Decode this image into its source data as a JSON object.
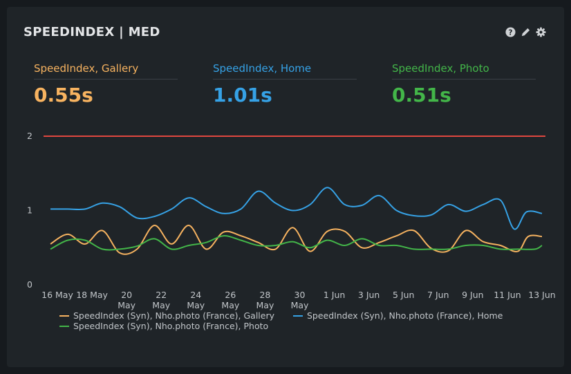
{
  "panel": {
    "title": "SPEEDINDEX | MED",
    "icons": [
      "help-icon",
      "edit-icon",
      "gear-icon"
    ]
  },
  "metrics": [
    {
      "label": "SpeedIndex, Gallery",
      "value": "0.55s",
      "color": "#f7b360"
    },
    {
      "label": "SpeedIndex, Home",
      "value": "1.01s",
      "color": "#36a2e6"
    },
    {
      "label": "SpeedIndex, Photo",
      "value": "0.51s",
      "color": "#43b649"
    }
  ],
  "chart_data": {
    "type": "line",
    "x_labels": [
      [
        "16 May"
      ],
      [
        "18 May"
      ],
      [
        "20",
        "May"
      ],
      [
        "22",
        "May"
      ],
      [
        "24",
        "May"
      ],
      [
        "26",
        "May"
      ],
      [
        "28",
        "May"
      ],
      [
        "30",
        "May"
      ],
      [
        "1 Jun"
      ],
      [
        "3 Jun"
      ],
      [
        "5 Jun"
      ],
      [
        "7 Jun"
      ],
      [
        "9 Jun"
      ],
      [
        "11 Jun"
      ],
      [
        "13 Jun"
      ]
    ],
    "x_range": [
      0,
      28.4
    ],
    "y_ticks": [
      "0",
      "1",
      "2"
    ],
    "ylim": [
      0,
      2
    ],
    "threshold": {
      "value": 2,
      "color": "#e0473f"
    },
    "grid": false,
    "legend_position": "bottom",
    "series": [
      {
        "name": "SpeedIndex (Syn), Nho.photo (France), Gallery",
        "color": "#f7b360",
        "points": [
          [
            0,
            0.55
          ],
          [
            1,
            0.68
          ],
          [
            2,
            0.55
          ],
          [
            3,
            0.73
          ],
          [
            4,
            0.43
          ],
          [
            5,
            0.48
          ],
          [
            6,
            0.8
          ],
          [
            7,
            0.55
          ],
          [
            8,
            0.8
          ],
          [
            9,
            0.48
          ],
          [
            10,
            0.71
          ],
          [
            11,
            0.66
          ],
          [
            12,
            0.57
          ],
          [
            13,
            0.48
          ],
          [
            14,
            0.77
          ],
          [
            15,
            0.45
          ],
          [
            16,
            0.72
          ],
          [
            17,
            0.72
          ],
          [
            18,
            0.5
          ],
          [
            19,
            0.57
          ],
          [
            20,
            0.66
          ],
          [
            21,
            0.73
          ],
          [
            22,
            0.49
          ],
          [
            23,
            0.46
          ],
          [
            24,
            0.73
          ],
          [
            25,
            0.58
          ],
          [
            26,
            0.53
          ],
          [
            27,
            0.45
          ],
          [
            27.6,
            0.65
          ],
          [
            28.4,
            0.65
          ]
        ]
      },
      {
        "name": "SpeedIndex (Syn), Nho.photo (France), Home",
        "color": "#36a2e6",
        "points": [
          [
            0,
            1.02
          ],
          [
            1,
            1.02
          ],
          [
            2,
            1.02
          ],
          [
            3,
            1.1
          ],
          [
            4,
            1.05
          ],
          [
            5,
            0.9
          ],
          [
            6,
            0.92
          ],
          [
            7,
            1.02
          ],
          [
            8,
            1.17
          ],
          [
            9,
            1.05
          ],
          [
            10,
            0.96
          ],
          [
            11,
            1.02
          ],
          [
            12,
            1.26
          ],
          [
            13,
            1.1
          ],
          [
            14,
            1.0
          ],
          [
            15,
            1.08
          ],
          [
            16,
            1.31
          ],
          [
            17,
            1.08
          ],
          [
            18,
            1.07
          ],
          [
            19,
            1.2
          ],
          [
            20,
            1.0
          ],
          [
            21,
            0.93
          ],
          [
            22,
            0.94
          ],
          [
            23,
            1.08
          ],
          [
            24,
            0.99
          ],
          [
            25,
            1.08
          ],
          [
            26,
            1.14
          ],
          [
            26.8,
            0.75
          ],
          [
            27.5,
            0.98
          ],
          [
            28.4,
            0.96
          ]
        ]
      },
      {
        "name": "SpeedIndex (Syn), Nho.photo (France), Photo",
        "color": "#43b649",
        "points": [
          [
            0,
            0.48
          ],
          [
            1,
            0.6
          ],
          [
            2,
            0.6
          ],
          [
            3,
            0.48
          ],
          [
            4,
            0.48
          ],
          [
            5,
            0.52
          ],
          [
            6,
            0.62
          ],
          [
            7,
            0.48
          ],
          [
            8,
            0.53
          ],
          [
            9,
            0.57
          ],
          [
            10,
            0.66
          ],
          [
            11,
            0.6
          ],
          [
            12,
            0.53
          ],
          [
            13,
            0.53
          ],
          [
            14,
            0.58
          ],
          [
            15,
            0.5
          ],
          [
            16,
            0.6
          ],
          [
            17,
            0.53
          ],
          [
            18,
            0.62
          ],
          [
            19,
            0.53
          ],
          [
            20,
            0.53
          ],
          [
            21,
            0.48
          ],
          [
            22,
            0.48
          ],
          [
            23,
            0.48
          ],
          [
            24,
            0.53
          ],
          [
            25,
            0.53
          ],
          [
            26,
            0.48
          ],
          [
            27,
            0.48
          ],
          [
            28,
            0.48
          ],
          [
            28.4,
            0.53
          ]
        ]
      }
    ]
  }
}
